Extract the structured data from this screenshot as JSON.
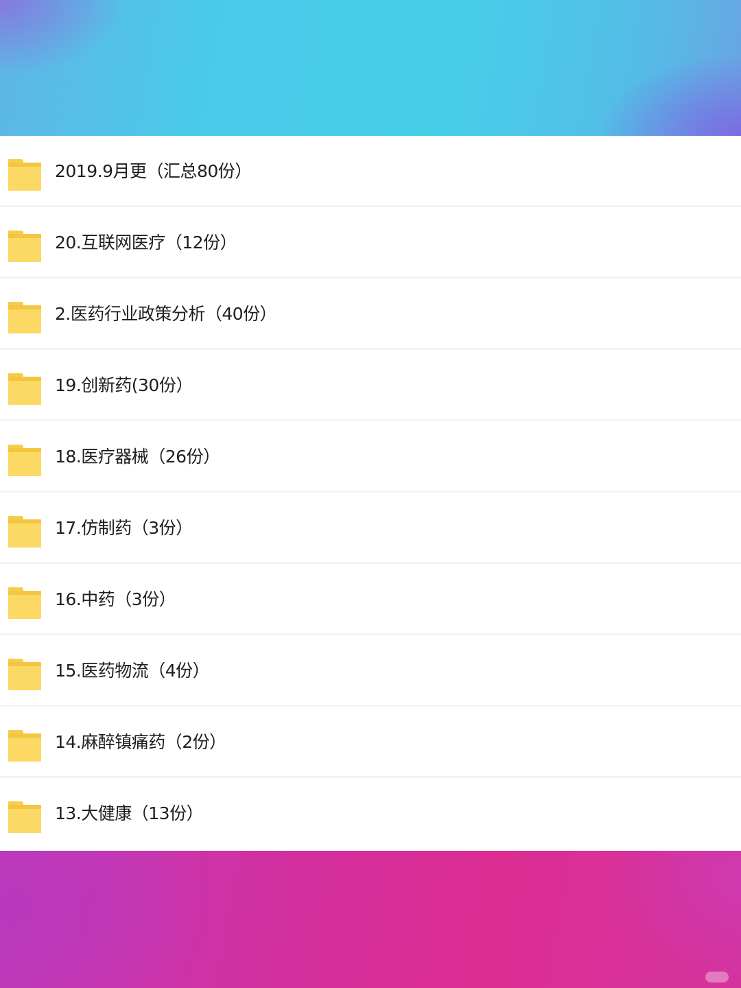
{
  "folders": [
    {
      "name": "2019.9月更（汇总80份）"
    },
    {
      "name": "20.互联网医疗（12份）"
    },
    {
      "name": "2.医药行业政策分析（40份）"
    },
    {
      "name": "19.创新药(30份）"
    },
    {
      "name": "18.医疗器械（26份）"
    },
    {
      "name": "17.仿制药（3份）"
    },
    {
      "name": "16.中药（3份）"
    },
    {
      "name": "15.医药物流（4份）"
    },
    {
      "name": "14.麻醉镇痛药（2份）"
    },
    {
      "name": "13.大健康（13份）"
    }
  ],
  "icon": "folder-icon",
  "colors": {
    "folder": "#fcd964",
    "top_banner": "#47cfe8",
    "bottom_banner": "#dc2d92"
  }
}
